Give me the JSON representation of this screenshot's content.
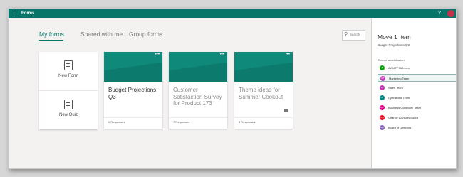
{
  "app": {
    "title": "Forms",
    "grid_icon": "app-launcher-icon",
    "help_icon": "question-mark-icon",
    "help_glyph": "?",
    "brand_color": "#077568",
    "profile_color": "#c4314b"
  },
  "tabs": [
    {
      "label": "My forms",
      "active": true
    },
    {
      "label": "Shared with me",
      "active": false
    },
    {
      "label": "Group forms",
      "active": false
    }
  ],
  "search": {
    "placeholder": "Search"
  },
  "new_items": {
    "form_label": "New Form",
    "quiz_label": "New Quiz"
  },
  "cards": [
    {
      "title": "Budget Projections Q3",
      "responses": "0 Responses",
      "title_color": "#333333"
    },
    {
      "title": "Customer Satisfaction Survey for Product 173",
      "responses": "7 Responses",
      "title_color": "#8a8a8a"
    },
    {
      "title": "Theme ideas for Summer Cookout",
      "responses": "3 Responses",
      "title_color": "#8a8a8a"
    }
  ],
  "move_panel": {
    "title": "Move 1 Item",
    "item_name": "Budget Projections Q3",
    "choose_label": "Choose a destination",
    "destinations": [
      {
        "label": "AV MTP365.com",
        "color": "#13a10e",
        "initials": "A",
        "selected": false
      },
      {
        "label": "Marketing Team",
        "color": "#c239b3",
        "initials": "MT",
        "selected": true
      },
      {
        "label": "Sales Team",
        "color": "#c239b3",
        "initials": "ST",
        "selected": false
      },
      {
        "label": "Operations Team",
        "color": "#038387",
        "initials": "OT",
        "selected": false
      },
      {
        "label": "Business Continuity Team",
        "color": "#e3008c",
        "initials": "BC",
        "selected": false
      },
      {
        "label": "Change Advisory Board",
        "color": "#e81123",
        "initials": "CA",
        "selected": false
      },
      {
        "label": "Board of Directors",
        "color": "#8764b8",
        "initials": "BD",
        "selected": false
      }
    ]
  }
}
